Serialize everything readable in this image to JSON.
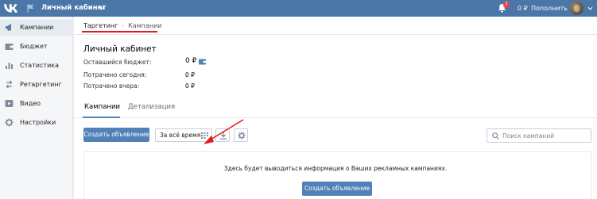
{
  "header": {
    "title": "Личный кабинет",
    "notifications_count": "7",
    "balance": "0 ₽",
    "topup_label": "Пополнить"
  },
  "sidebar": {
    "items": [
      {
        "label": "Кампании",
        "icon": "megaphone-icon",
        "active": true
      },
      {
        "label": "Бюджет",
        "icon": "wallet-icon",
        "active": false
      },
      {
        "label": "Статистика",
        "icon": "bar-chart-icon",
        "active": false
      },
      {
        "label": "Ретаргетинг",
        "icon": "retarget-icon",
        "active": false
      },
      {
        "label": "Видео",
        "icon": "play-icon",
        "active": false
      },
      {
        "label": "Настройки",
        "icon": "gear-icon",
        "active": false
      }
    ]
  },
  "breadcrumb": {
    "items": [
      "Таргетинг",
      "Кампании"
    ]
  },
  "main": {
    "title": "Личный кабинет",
    "stats": [
      {
        "label": "Оставшийся бюджет:",
        "value": "0 ₽"
      },
      {
        "label": "Потрачено сегодня:",
        "value": "0 ₽"
      },
      {
        "label": "Потрачено вчера:",
        "value": "0 ₽"
      }
    ],
    "tabs": [
      {
        "label": "Кампании",
        "active": true
      },
      {
        "label": "Детализация",
        "active": false
      }
    ],
    "toolbar": {
      "create_label": "Создать объявление",
      "period_label": "За всё время"
    },
    "search": {
      "placeholder": "Поиск кампаний",
      "value": ""
    },
    "empty_state": {
      "text": "Здесь будет выводиться информация о Ваших рекламных кампаниях.",
      "button_label": "Создать объявление"
    }
  },
  "colors": {
    "header_bg": "#4a76a8",
    "primary_button": "#5181b8",
    "annotation_red": "#e31b1b",
    "badge": "#e64646"
  }
}
